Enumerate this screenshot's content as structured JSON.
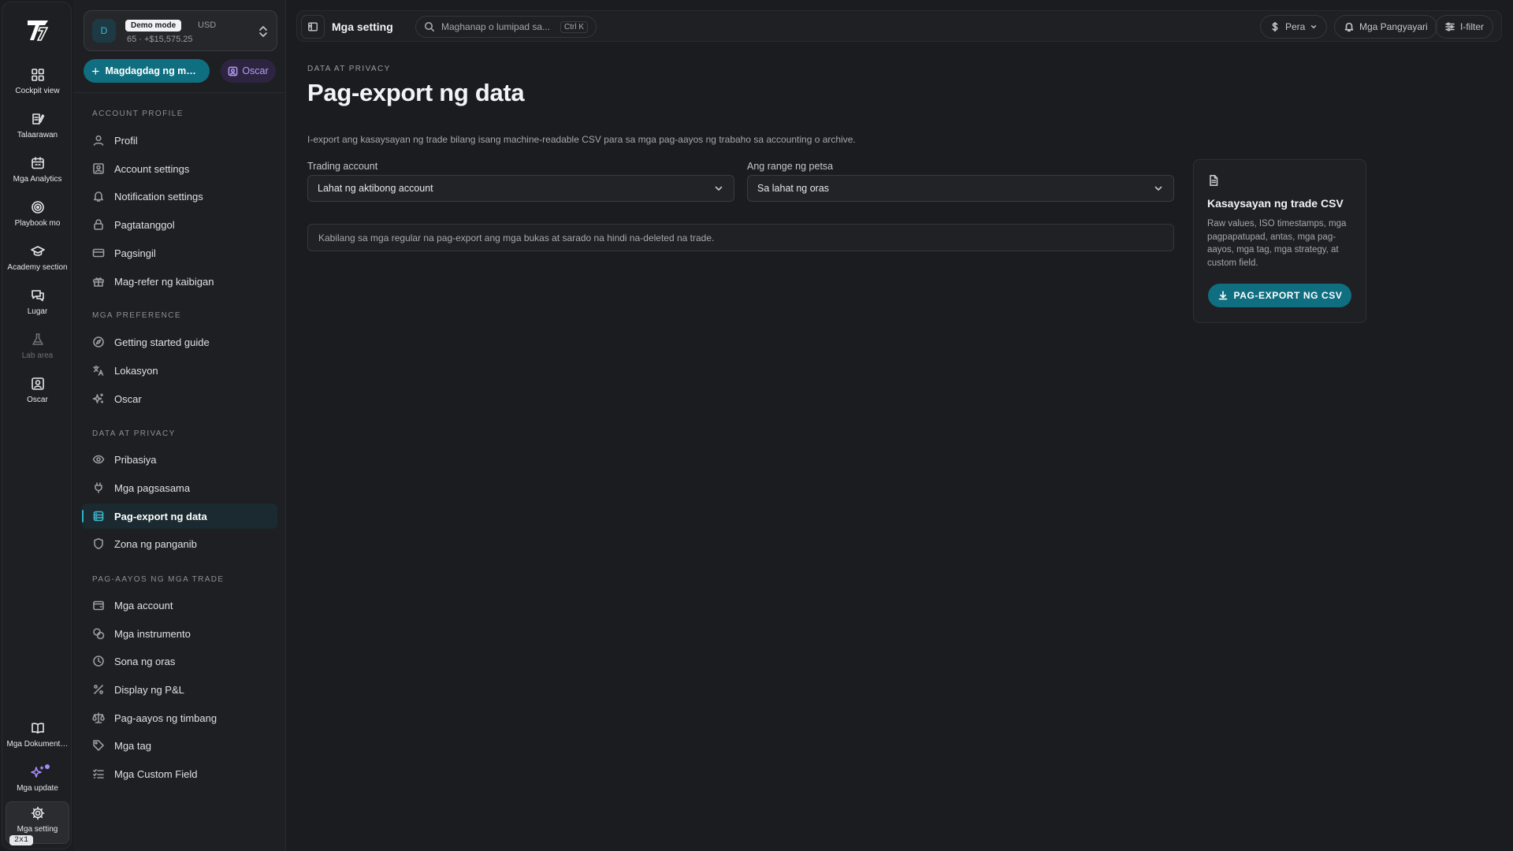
{
  "rail": {
    "items": [
      {
        "label": "Cockpit view",
        "icon": "grid-icon"
      },
      {
        "label": "Talaarawan",
        "icon": "journal-icon"
      },
      {
        "label": "Mga Analytics",
        "icon": "calendar-icon"
      },
      {
        "label": "Playbook mo",
        "icon": "target-icon"
      },
      {
        "label": "Academy section",
        "icon": "graduation-cap-icon"
      },
      {
        "label": "Lugar",
        "icon": "chat-icon"
      },
      {
        "label": "Lab area",
        "icon": "flask-icon"
      },
      {
        "label": "Oscar",
        "icon": "user-square-icon"
      }
    ],
    "bottom": [
      {
        "label": "Mga Dokumentasyon",
        "icon": "book-icon"
      },
      {
        "label": "Mga update",
        "icon": "sparkles-icon"
      },
      {
        "label": "Mga setting",
        "icon": "gear-icon"
      }
    ],
    "scale_badge": "2x1"
  },
  "account": {
    "avatar": "D",
    "mode": "Demo mode",
    "currency": "USD",
    "balance": "65 · +$15,575.25"
  },
  "actions": {
    "add_label": "Magdagdag ng mga trade",
    "oscar_label": "Oscar"
  },
  "sidebar": {
    "sections": [
      {
        "title": "ACCOUNT PROFILE",
        "items": [
          {
            "label": "Profil",
            "icon": "user-icon"
          },
          {
            "label": "Account settings",
            "icon": "id-card-icon"
          },
          {
            "label": "Notification settings",
            "icon": "bell-icon"
          },
          {
            "label": "Pagtatanggol",
            "icon": "lock-icon"
          },
          {
            "label": "Pagsingil",
            "icon": "credit-card-icon"
          },
          {
            "label": "Mag-refer ng kaibigan",
            "icon": "gift-icon"
          }
        ]
      },
      {
        "title": "MGA PREFERENCE",
        "items": [
          {
            "label": "Getting started guide",
            "icon": "compass-icon"
          },
          {
            "label": "Lokasyon",
            "icon": "translate-icon"
          },
          {
            "label": "Oscar",
            "icon": "sparkle-icon"
          }
        ]
      },
      {
        "title": "DATA AT PRIVACY",
        "items": [
          {
            "label": "Pribasiya",
            "icon": "eye-icon"
          },
          {
            "label": "Mga pagsasama",
            "icon": "plug-icon"
          },
          {
            "label": "Pag-export ng data",
            "icon": "database-icon"
          },
          {
            "label": "Zona ng panganib",
            "icon": "shield-icon"
          }
        ]
      },
      {
        "title": "PAG-AAYOS NG MGA TRADE",
        "items": [
          {
            "label": "Mga account",
            "icon": "wallet-icon"
          },
          {
            "label": "Mga instrumento",
            "icon": "coins-icon"
          },
          {
            "label": "Sona ng oras",
            "icon": "clock-icon"
          },
          {
            "label": "Display ng P&L",
            "icon": "percent-icon"
          },
          {
            "label": "Pag-aayos ng timbang",
            "icon": "scale-icon"
          },
          {
            "label": "Mga tag",
            "icon": "tag-icon"
          },
          {
            "label": "Mga Custom Field",
            "icon": "list-check-icon"
          }
        ]
      }
    ],
    "active": "Pag-export ng data"
  },
  "topbar": {
    "title": "Mga setting",
    "search_placeholder": "Maghanap o lumipad sa...",
    "search_shortcut": "Ctrl K",
    "currency_label": "Pera",
    "events_label": "Mga Pangyayari",
    "filter_label": "I-filter"
  },
  "page": {
    "breadcrumb": "DATA AT PRIVACY",
    "title": "Pag-export ng data",
    "description": "I-export ang kasaysayan ng trade bilang isang machine-readable CSV para sa mga pag-aayos ng trabaho sa accounting o archive.",
    "trading_account_label": "Trading account",
    "trading_account_value": "Lahat ng aktibong account",
    "date_range_label": "Ang range ng petsa",
    "date_range_value": "Sa lahat ng oras",
    "info_text": "Kabilang sa mga regular na pag-export ang mga bukas at sarado na hindi na-deleted na trade."
  },
  "export_card": {
    "title": "Kasaysayan ng trade CSV",
    "description": "Raw values, ISO timestamps, mga pagpapatupad, antas, mga pag-aayos, mga tag, mga strategy, at custom field.",
    "button_label": "PAG-EXPORT NG CSV"
  },
  "colors": {
    "accent": "#0f6f80",
    "accent_text": "#2fb3c9",
    "oscar": "#b69cf7",
    "background": "#1b1c1f"
  }
}
